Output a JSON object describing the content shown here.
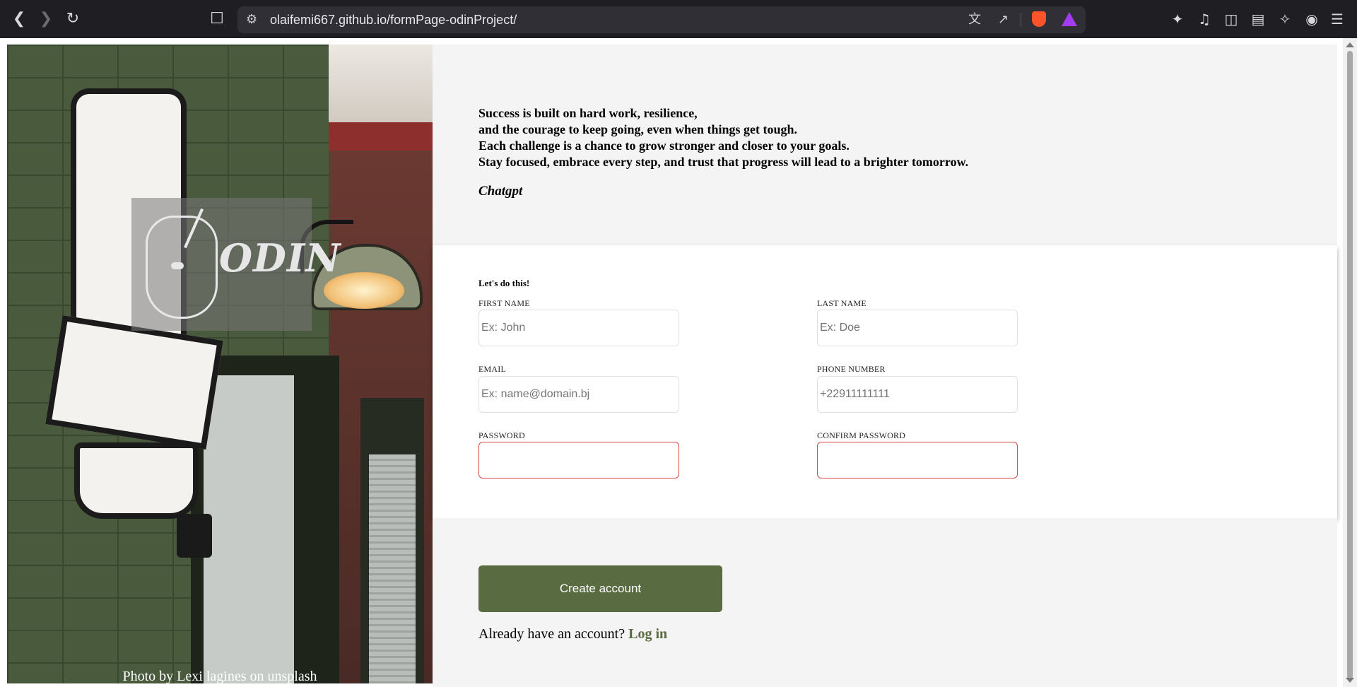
{
  "browser": {
    "url": "olaifemi667.github.io/formPage-odinProject/",
    "icons": [
      "back-icon",
      "forward-icon",
      "reload-icon",
      "bookmark-icon",
      "site-info-icon",
      "translate-icon",
      "share-icon",
      "brave-shields-icon",
      "brave-rewards-icon",
      "extensions-icon",
      "media-icon",
      "sidebar-icon",
      "wallet-icon",
      "leo-ai-icon",
      "vpn-icon",
      "menu-icon"
    ]
  },
  "hero": {
    "logo_text": "ODIN",
    "credit": "Photo by Lexi lagines on unsplash"
  },
  "quote": {
    "lines": [
      "Success is built on hard work, resilience,",
      "and the courage to keep going, even when things get tough.",
      "Each challenge is a chance to grow stronger and closer to your goals.",
      "Stay focused, embrace every step, and trust that progress will lead to a brighter tomorrow."
    ],
    "author": "Chatgpt"
  },
  "form": {
    "heading": "Let's do this!",
    "first_name": {
      "label": "FIRST NAME",
      "placeholder": "Ex: John",
      "value": ""
    },
    "last_name": {
      "label": "LAST NAME",
      "placeholder": "Ex: Doe",
      "value": ""
    },
    "email": {
      "label": "EMAIL",
      "placeholder": "Ex: name@domain.bj",
      "value": ""
    },
    "phone": {
      "label": "PHONE NUMBER",
      "placeholder": "+22911111111",
      "value": ""
    },
    "password": {
      "label": "PASSWORD",
      "value": ""
    },
    "confirm_password": {
      "label": "CONFIRM PASSWORD",
      "value": ""
    },
    "invalid_border_color": "#e0473f"
  },
  "actions": {
    "create_label": "Create account",
    "prompt": "Already have an account?",
    "login_label": "Log in",
    "accent_color": "#596b41"
  }
}
